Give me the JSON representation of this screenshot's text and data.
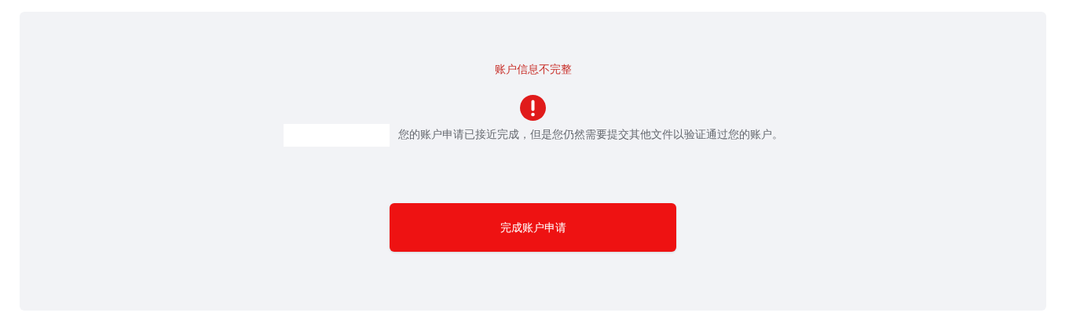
{
  "notice": {
    "title": "账户信息不完整",
    "message": "您的账户申请已接近完成，但是您仍然需要提交其他文件以验证通过您的账户。",
    "button": "完成账户申请"
  }
}
